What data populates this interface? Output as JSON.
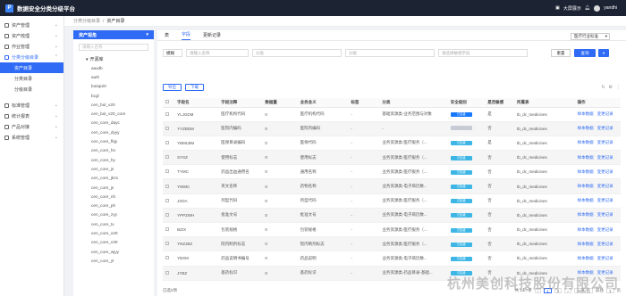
{
  "app": {
    "title": "数据安全分类分级平台",
    "logo_letter": "P"
  },
  "topbar": {
    "screen_label": "大屏展示",
    "username": "yandhi"
  },
  "sidebar": {
    "items": [
      {
        "label": "资产管理"
      },
      {
        "label": "资产梳理"
      },
      {
        "label": "作业管理"
      },
      {
        "label": "分类分级目录"
      }
    ],
    "subitems": [
      {
        "label": "资产目录"
      },
      {
        "label": "分类目录"
      },
      {
        "label": "分级目录"
      }
    ],
    "items2": [
      {
        "label": "标准管理"
      },
      {
        "label": "统计报表"
      },
      {
        "label": "产品对接"
      },
      {
        "label": "系统管理"
      }
    ]
  },
  "breadcrumb": {
    "parent": "分类分级目录",
    "sep": "/",
    "current": "资产目录"
  },
  "tree": {
    "header": "资产视角",
    "search_placeholder": "请输入名称",
    "root": "开源库",
    "items": [
      "aaxdb",
      "auth",
      "boiap20",
      "bcgl",
      "cen_bul_v20",
      "cen_bul_v20_core",
      "cen_core_dayc",
      "cen_core_dyyy",
      "cen_core_fbjy",
      "cen_core_hn",
      "cen_core_hy",
      "cen_core_js",
      "cen_core_jkzs",
      "cen_core_js",
      "cen_core_nh",
      "cen_core_ph",
      "cen_core_zyy",
      "cen_core_tx",
      "cen_core_v20",
      "cen_core_v30",
      "cen_core_wjyy",
      "cen_core_yl"
    ]
  },
  "tabs": [
    "表",
    "字段",
    "更新记录"
  ],
  "industry_select": "医疗行业标准",
  "filters": {
    "f1": "模糊",
    "f1_ph": "请输入名称",
    "f2_ph": "分类",
    "f3_ph": "分级",
    "f4_ph": "请选择敏感字段",
    "reset": "重置",
    "search": "查询"
  },
  "actions": {
    "export": "导出",
    "download": "下载"
  },
  "tools": [
    "↻",
    "⚙",
    "⋮"
  ],
  "table": {
    "headers": [
      "字段名",
      "字段注释",
      "数据量",
      "业务含义",
      "标签",
      "分类",
      "安全级别",
      "是否敏感",
      "所属表",
      "操作"
    ],
    "rows": [
      {
        "name": "YLJGDM",
        "comment": "医疗机构代码",
        "count": "0",
        "meaning": "医疗机构代码",
        "tag": "-",
        "cls": "基础资源类-业务范围与对象",
        "level": "已定级",
        "lvc": "#1677ff",
        "sens": "是",
        "table": "tb_dc_medicines",
        "op1": "样本数据",
        "op2": "变更记录"
      },
      {
        "name": "YYZBDM",
        "comment": "医院内编码",
        "count": "0",
        "meaning": "医院内编码",
        "tag": "-",
        "cls": "-",
        "level": "",
        "lvc": "#c6cbd6",
        "sens": "否",
        "table": "tb_dc_medicines",
        "op1": "样本数据",
        "op2": "变更记录"
      },
      {
        "name": "YBMLBM",
        "comment": "医保目录编码",
        "count": "0",
        "meaning": "医保代码",
        "tag": "-",
        "cls": "业务资源类-医疗服务（...",
        "level": "已定级",
        "lvc": "#3db6e6",
        "sens": "是",
        "table": "tb_dc_medicines",
        "op1": "样本数据",
        "op2": "变更记录"
      },
      {
        "name": "SYSZ",
        "comment": "使用标志",
        "count": "0",
        "meaning": "使用标志",
        "tag": "-",
        "cls": "业务资源类-医疗服务（...",
        "level": "已定级",
        "lvc": "#3db6e6",
        "sens": "否",
        "table": "tb_dc_medicines",
        "op1": "样本数据",
        "op2": "变更记录"
      },
      {
        "name": "TYMC",
        "comment": "药品出血通用名",
        "count": "0",
        "meaning": "通用名称",
        "tag": "-",
        "cls": "业务资源类-医疗服务（...",
        "level": "已定级",
        "lvc": "#3db6e6",
        "sens": "否",
        "table": "tb_dc_medicines",
        "op1": "样本数据",
        "op2": "变更记录"
      },
      {
        "name": "YWMC",
        "comment": "英文名称",
        "count": "0",
        "meaning": "药物名称",
        "tag": "-",
        "cls": "业务资源类-电子病历数...",
        "level": "已定级",
        "lvc": "#3db6e6",
        "sens": "否",
        "table": "tb_dc_medicines",
        "op1": "样本数据",
        "op2": "变更记录"
      },
      {
        "name": "JXDA",
        "comment": "剂型代码",
        "count": "0",
        "meaning": "剂型代码",
        "tag": "-",
        "cls": "业务资源类-医疗服务（...",
        "level": "已定级",
        "lvc": "#3db6e6",
        "sens": "否",
        "table": "tb_dc_medicines",
        "op1": "样本数据",
        "op2": "变更记录"
      },
      {
        "name": "YPPZWH",
        "comment": "批准文号",
        "count": "0",
        "meaning": "批准文号",
        "tag": "-",
        "cls": "业务资源类-电子病历数...",
        "level": "已定级",
        "lvc": "#3db6e6",
        "sens": "否",
        "table": "tb_dc_medicines",
        "op1": "样本数据",
        "op2": "变更记录"
      },
      {
        "name": "BZIX",
        "comment": "包装规格",
        "count": "0",
        "meaning": "包装规格",
        "tag": "-",
        "cls": "业务资源类-医疗服务（...",
        "level": "已定级",
        "lvc": "#3db6e6",
        "sens": "否",
        "table": "tb_dc_medicines",
        "op1": "样本数据",
        "op2": "变更记录"
      },
      {
        "name": "YNZJBZ",
        "comment": "院内制剂标志",
        "count": "0",
        "meaning": "院内制剂标志",
        "tag": "-",
        "cls": "业务资源类-医疗服务（...",
        "level": "已定级",
        "lvc": "#3db6e6",
        "sens": "否",
        "table": "tb_dc_medicines",
        "op1": "样本数据",
        "op2": "变更记录"
      },
      {
        "name": "YBXM",
        "comment": "药品说明书编号",
        "count": "0",
        "meaning": "药品说明",
        "tag": "-",
        "cls": "业务资源类-电子病历数...",
        "level": "已定级",
        "lvc": "#3db6e6",
        "sens": "否",
        "table": "tb_dc_medicines",
        "op1": "样本数据",
        "op2": "变更记录"
      },
      {
        "name": "JYBZ",
        "comment": "基药标识",
        "count": "0",
        "meaning": "基药标识",
        "tag": "-",
        "cls": "业务资源类-药品目录-基础...",
        "level": "已定级",
        "lvc": "#3db6e6",
        "sens": "否",
        "table": "tb_dc_medicines",
        "op1": "样本数据",
        "op2": "变更记录"
      }
    ]
  },
  "footer": {
    "selected": "已选0项",
    "total": "共 14/7条",
    "pages": [
      "1",
      "2"
    ],
    "page_size": "20条/页",
    "goto": "前往",
    "goto_page": "1",
    "page_unit": "页"
  },
  "watermark": "杭州美创科技股份有限公司"
}
